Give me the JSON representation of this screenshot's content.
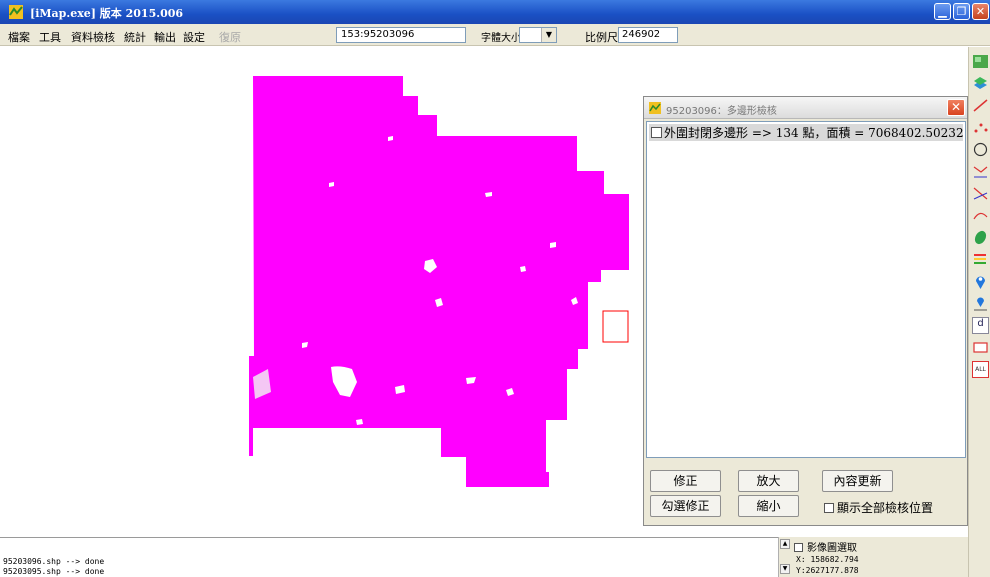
{
  "window": {
    "title": "[iMap.exe] 版本 2015.006",
    "min_glyph": "▁",
    "max_glyph": "❐",
    "close_glyph": "✕"
  },
  "menu": {
    "items": [
      "檔案",
      "工具",
      "資料檢核",
      "統計",
      "輸出",
      "設定",
      "復原"
    ],
    "coord_value": "153:95203096",
    "font_label": "字體大小",
    "font_value": "",
    "scale_label": "比例尺",
    "scale_value": "246902"
  },
  "map": {
    "fill_color": "#ff00ff",
    "selection_color": "#ff0000"
  },
  "dialog": {
    "title": "95203096：多邊形檢核",
    "close_glyph": "✕",
    "list_items": [
      {
        "text": "外圍封閉多邊形 => 134 點，面積 = 7068402.50232",
        "checked": false
      }
    ],
    "buttons": {
      "fix": "修正",
      "zoom_in": "放大",
      "refresh": "內容更新",
      "check_fix": "勾選修正",
      "zoom_out": "縮小"
    },
    "show_all_label": "顯示全部檢核位置"
  },
  "log": {
    "lines": [
      "95203096.shp --> done",
      "95203095.shp --> done"
    ]
  },
  "status": {
    "image_select_label": "影像圖選取",
    "x": "X: 158682.794",
    "y": "Y:2627177.878"
  },
  "toolbar": {
    "icons": [
      "image-icon",
      "layers-icon",
      "line-icon",
      "points-icon",
      "circle-icon",
      "polyline-icon",
      "cross-line-icon",
      "curve-icon",
      "shape-icon",
      "legend-icon",
      "pin-icon",
      "pin-list-icon",
      "distance-icon",
      "rectangle-icon",
      "all-icon"
    ],
    "all_label": "ALL",
    "distance_label": "d"
  }
}
